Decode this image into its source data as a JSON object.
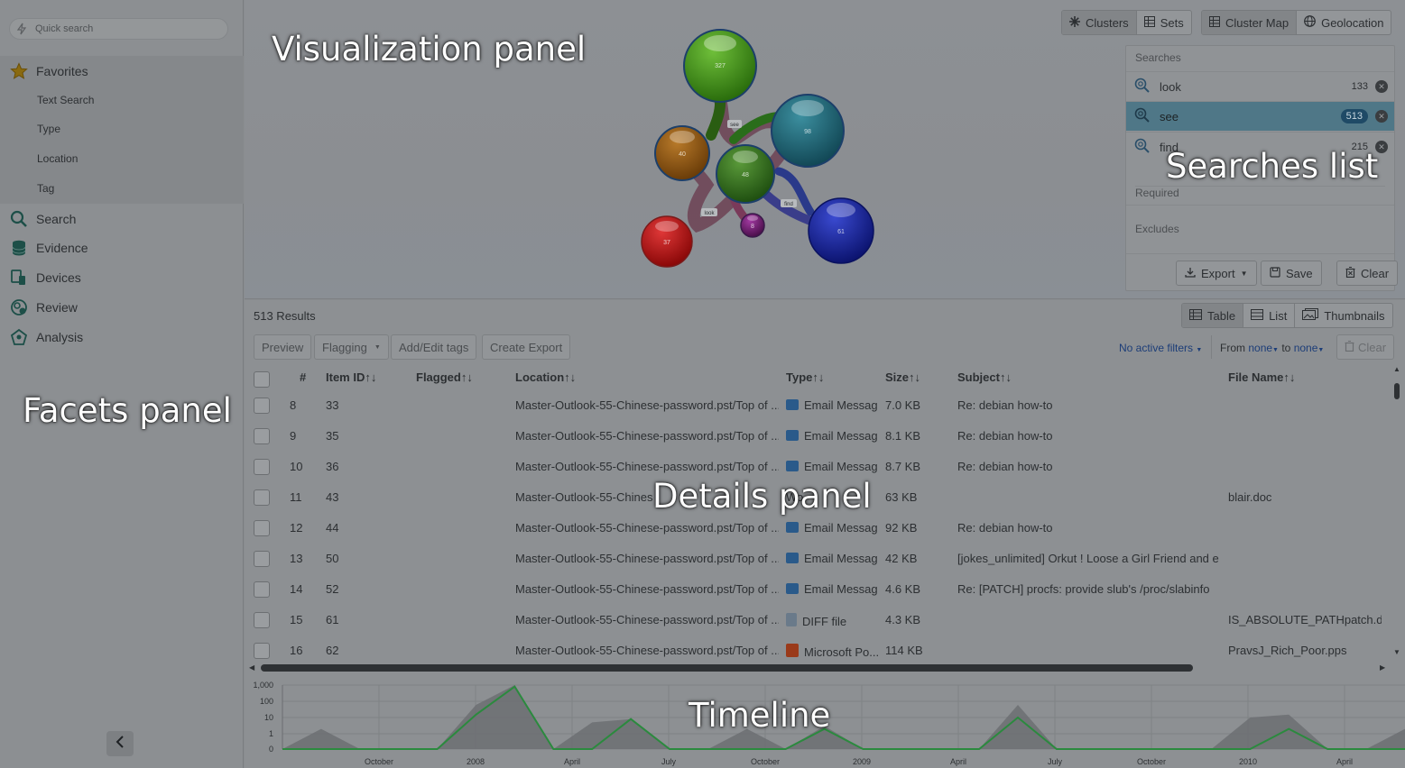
{
  "labels": {
    "facets": "Facets panel",
    "visualization": "Visualization panel",
    "searches_list": "Searches list",
    "details": "Details panel",
    "timeline": "Timeline"
  },
  "quick_search": {
    "placeholder": "Quick search"
  },
  "facets": {
    "favorites": "Favorites",
    "favorites_items": [
      "Text Search",
      "Type",
      "Location",
      "Tag"
    ],
    "items": [
      "Search",
      "Evidence",
      "Devices",
      "Review",
      "Analysis"
    ]
  },
  "viz_toolbar": {
    "left": [
      {
        "label": "Clusters",
        "icon": "asterisk-icon"
      },
      {
        "label": "Sets",
        "icon": "grid-icon"
      }
    ],
    "right": [
      {
        "label": "Cluster Map",
        "icon": "grid-icon"
      },
      {
        "label": "Geolocation",
        "icon": "globe-icon"
      }
    ]
  },
  "cluster_map": {
    "clusters": [
      {
        "count": "327",
        "color": "#3a8a12"
      },
      {
        "count": "98",
        "color": "#1a5d70"
      },
      {
        "count": "40",
        "color": "#8a4e10"
      },
      {
        "count": "48",
        "color": "#2f6a1c"
      },
      {
        "count": "37",
        "color": "#b01010"
      },
      {
        "count": "8",
        "color": "#6a1a6a"
      },
      {
        "count": "61",
        "color": "#12208a"
      }
    ],
    "tags": [
      "see",
      "find",
      "look"
    ]
  },
  "searches": {
    "header": "Searches",
    "items": [
      {
        "name": "look",
        "count": "133",
        "selected": false
      },
      {
        "name": "see",
        "count": "513",
        "selected": true
      },
      {
        "name": "find",
        "count": "215",
        "selected": false
      }
    ],
    "required": "Required",
    "excludes": "Excludes",
    "export": "Export",
    "save": "Save",
    "clear": "Clear"
  },
  "details": {
    "results": "513 Results",
    "views": [
      "Table",
      "List",
      "Thumbnails"
    ],
    "actions": [
      "Preview",
      "Flagging",
      "Add/Edit tags",
      "Create Export"
    ],
    "filters": {
      "no_active": "No active filters",
      "from": "From",
      "from_value": "none",
      "to": "to",
      "to_value": "none",
      "clear": "Clear"
    },
    "columns": [
      "#",
      "Item ID↑↓",
      "Flagged↑↓",
      "Location↑↓",
      "Type↑↓",
      "Size↑↓",
      "Subject↑↓",
      "File Name↑↓"
    ],
    "rows": [
      {
        "num": "8",
        "id": "33",
        "location": "Master-Outlook-55-Chinese-password.pst/Top of ...",
        "type": "Email Message",
        "type_icon": "email",
        "size": "7.0 KB",
        "subject": "Re: debian how-to",
        "filename": ""
      },
      {
        "num": "9",
        "id": "35",
        "location": "Master-Outlook-55-Chinese-password.pst/Top of ...",
        "type": "Email Message",
        "type_icon": "email",
        "size": "8.1 KB",
        "subject": "Re: debian how-to",
        "filename": ""
      },
      {
        "num": "10",
        "id": "36",
        "location": "Master-Outlook-55-Chinese-password.pst/Top of ...",
        "type": "Email Message",
        "type_icon": "email",
        "size": "8.7 KB",
        "subject": "Re: debian how-to",
        "filename": ""
      },
      {
        "num": "11",
        "id": "43",
        "location": "Master-Outlook-55-Chines",
        "type": "Wo",
        "type_icon": "",
        "size": "63 KB",
        "subject": "",
        "filename": "blair.doc"
      },
      {
        "num": "12",
        "id": "44",
        "location": "Master-Outlook-55-Chinese-password.pst/Top of ...",
        "type": "Email Message",
        "type_icon": "email",
        "size": "92 KB",
        "subject": "Re: debian how-to",
        "filename": ""
      },
      {
        "num": "13",
        "id": "50",
        "location": "Master-Outlook-55-Chinese-password.pst/Top of ...",
        "type": "Email Message",
        "type_icon": "email",
        "size": "42 KB",
        "subject": "[jokes_unlimited] Orkut ! Loose a Girl Friend and e...",
        "filename": ""
      },
      {
        "num": "14",
        "id": "52",
        "location": "Master-Outlook-55-Chinese-password.pst/Top of ...",
        "type": "Email Message",
        "type_icon": "email",
        "size": "4.6 KB",
        "subject": "Re: [PATCH] procfs: provide slub's /proc/slabinfo",
        "filename": ""
      },
      {
        "num": "15",
        "id": "61",
        "location": "Master-Outlook-55-Chinese-password.pst/Top of ...",
        "type": "DIFF file",
        "type_icon": "diff",
        "size": "4.3 KB",
        "subject": "",
        "filename": "IS_ABSOLUTE_PATHpatch.diff"
      },
      {
        "num": "16",
        "id": "62",
        "location": "Master-Outlook-55-Chinese-password.pst/Top of ...",
        "type": "Microsoft Po...",
        "type_icon": "ppt",
        "size": "114 KB",
        "subject": "",
        "filename": "PravsJ_Rich_Poor.pps"
      }
    ]
  },
  "chart_data": {
    "type": "area",
    "y_ticks": [
      "1,000",
      "100",
      "10",
      "1",
      "0"
    ],
    "x_ticks": [
      "October",
      "2008",
      "April",
      "July",
      "October",
      "2009",
      "April",
      "July",
      "October",
      "2010",
      "April"
    ],
    "ylim": [
      0,
      1000
    ],
    "series": [
      {
        "values": [
          0,
          0,
          0,
          0,
          0,
          15,
          800,
          0,
          0,
          8,
          0,
          0,
          0,
          0,
          2,
          0,
          0,
          0,
          0,
          10,
          0,
          0,
          0,
          0,
          0,
          0,
          2,
          0,
          0,
          0
        ]
      },
      {
        "values": [
          0,
          2,
          0,
          0,
          0,
          60,
          1000,
          0,
          5,
          8,
          0,
          0,
          2,
          0,
          3,
          0,
          0,
          0,
          0,
          60,
          0,
          0,
          0,
          0,
          0,
          10,
          15,
          0,
          0,
          2
        ]
      }
    ],
    "colors": {
      "line": "#2b8a3e",
      "area": "#6a6d70"
    }
  }
}
